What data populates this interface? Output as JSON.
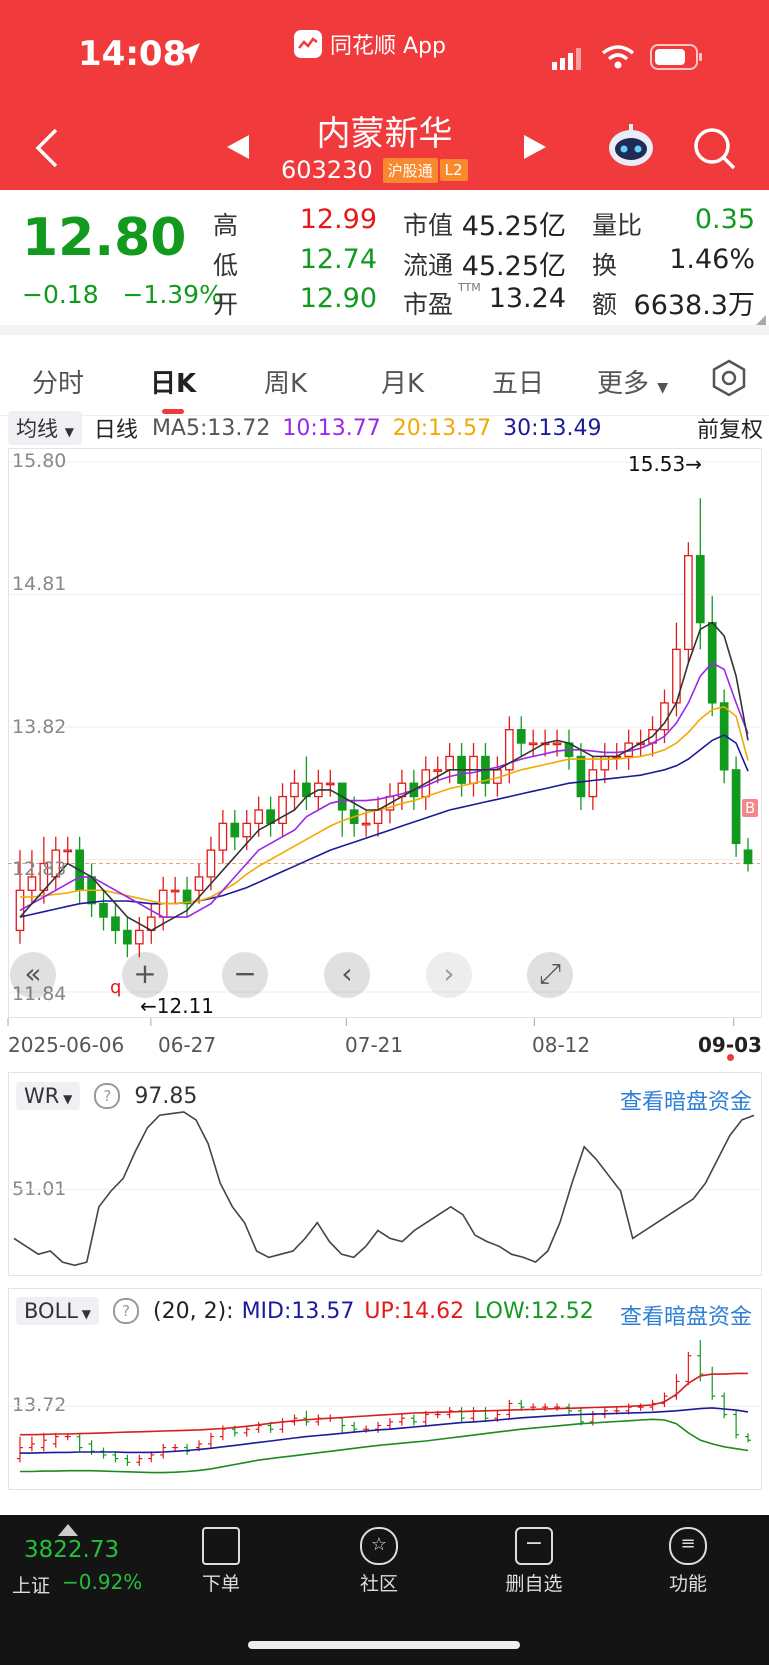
{
  "status": {
    "time": "14:08",
    "app_name": "同花顺 App"
  },
  "header": {
    "stock_name": "内蒙新华",
    "stock_code": "603230",
    "badge_connect": "沪股通",
    "badge_level": "L2"
  },
  "quote": {
    "price": "12.80",
    "change": "−0.18",
    "change_pct": "−1.39%",
    "high_label": "高",
    "high": "12.99",
    "low_label": "低",
    "low": "12.74",
    "open_label": "开",
    "open": "12.90",
    "mktcap_label": "市值",
    "mktcap": "45.25亿",
    "float_label": "流通",
    "float": "45.25亿",
    "pe_label": "市盈",
    "pe_sup": "TTM",
    "pe": "13.24",
    "volratio_label": "量比",
    "volratio": "0.35",
    "turnover_label": "换",
    "turnover": "1.46%",
    "amount_label": "额",
    "amount": "6638.3万"
  },
  "tabs": [
    "分时",
    "日K",
    "周K",
    "月K",
    "五日",
    "更多"
  ],
  "active_tab": 1,
  "ma_row": {
    "selector": "均线",
    "period": "日线",
    "ma5": "MA5:13.72",
    "ma10": "10:13.77",
    "ma20": "20:13.57",
    "ma30": "30:13.49",
    "adjust": "前复权"
  },
  "kline": {
    "y_labels": [
      "15.80",
      "14.81",
      "13.82",
      "12.83",
      "11.84"
    ],
    "high_annot": "15.53→",
    "low_annot": "←12.11",
    "marker_b": "B",
    "marker_q": "q",
    "x_labels": [
      "2025-06-06",
      "06-27",
      "07-21",
      "08-12",
      "09-03"
    ]
  },
  "wr": {
    "name": "WR",
    "value": "97.85",
    "y_label": "51.01",
    "link": "查看暗盘资金"
  },
  "boll": {
    "name": "BOLL",
    "params": "(20, 2):",
    "mid": "MID:13.57",
    "up": "UP:14.62",
    "low": "LOW:12.52",
    "y_label": "13.72",
    "link": "查看暗盘资金"
  },
  "bottom": {
    "index_value": "3822.73",
    "index_name": "上证",
    "index_change": "−0.92%",
    "items": [
      "下单",
      "社区",
      "删自选",
      "功能"
    ]
  },
  "colors": {
    "up": "#e51919",
    "down": "#129a1f",
    "header": "#f03a3c",
    "ma5": "#333333",
    "ma10": "#9b27e8",
    "ma20": "#f2a900",
    "ma30": "#1b1b9a"
  },
  "chart_data": [
    {
      "type": "candlestick",
      "ylim": [
        11.84,
        15.8
      ],
      "x_ticks": [
        "2025-06-06",
        "06-27",
        "07-21",
        "08-12",
        "09-03"
      ],
      "candles": [
        [
          12.3,
          12.6,
          12.9,
          12.2
        ],
        [
          12.6,
          12.7,
          12.9,
          12.5
        ],
        [
          12.6,
          12.8,
          13.0,
          12.5
        ],
        [
          12.7,
          12.9,
          13.0,
          12.6
        ],
        [
          12.9,
          12.9,
          13.0,
          12.8
        ],
        [
          12.9,
          12.6,
          13.0,
          12.5
        ],
        [
          12.7,
          12.5,
          12.8,
          12.4
        ],
        [
          12.5,
          12.4,
          12.6,
          12.3
        ],
        [
          12.4,
          12.3,
          12.5,
          12.2
        ],
        [
          12.3,
          12.2,
          12.4,
          12.1
        ],
        [
          12.2,
          12.3,
          12.4,
          12.1
        ],
        [
          12.3,
          12.4,
          12.5,
          12.2
        ],
        [
          12.4,
          12.6,
          12.7,
          12.3
        ],
        [
          12.6,
          12.6,
          12.7,
          12.5
        ],
        [
          12.6,
          12.5,
          12.7,
          12.4
        ],
        [
          12.6,
          12.7,
          12.8,
          12.5
        ],
        [
          12.7,
          12.9,
          13.0,
          12.6
        ],
        [
          12.9,
          13.1,
          13.2,
          12.8
        ],
        [
          13.1,
          13.0,
          13.2,
          12.9
        ],
        [
          13.0,
          13.1,
          13.2,
          12.9
        ],
        [
          13.1,
          13.2,
          13.3,
          13.0
        ],
        [
          13.2,
          13.1,
          13.3,
          13.0
        ],
        [
          13.1,
          13.3,
          13.4,
          13.0
        ],
        [
          13.3,
          13.4,
          13.5,
          13.2
        ],
        [
          13.4,
          13.3,
          13.6,
          13.2
        ],
        [
          13.3,
          13.4,
          13.5,
          13.2
        ],
        [
          13.4,
          13.4,
          13.5,
          13.3
        ],
        [
          13.4,
          13.2,
          13.4,
          13.0
        ],
        [
          13.2,
          13.1,
          13.3,
          13.0
        ],
        [
          13.1,
          13.1,
          13.2,
          13.0
        ],
        [
          13.1,
          13.2,
          13.3,
          13.0
        ],
        [
          13.2,
          13.3,
          13.4,
          13.1
        ],
        [
          13.3,
          13.4,
          13.5,
          13.2
        ],
        [
          13.4,
          13.3,
          13.5,
          13.2
        ],
        [
          13.3,
          13.5,
          13.6,
          13.2
        ],
        [
          13.5,
          13.5,
          13.6,
          13.4
        ],
        [
          13.5,
          13.6,
          13.7,
          13.4
        ],
        [
          13.6,
          13.4,
          13.7,
          13.3
        ],
        [
          13.4,
          13.6,
          13.7,
          13.3
        ],
        [
          13.6,
          13.4,
          13.7,
          13.3
        ],
        [
          13.4,
          13.5,
          13.6,
          13.3
        ],
        [
          13.5,
          13.8,
          13.9,
          13.4
        ],
        [
          13.8,
          13.7,
          13.9,
          13.6
        ],
        [
          13.7,
          13.7,
          13.8,
          13.6
        ],
        [
          13.7,
          13.7,
          13.8,
          13.6
        ],
        [
          13.7,
          13.7,
          13.8,
          13.6
        ],
        [
          13.7,
          13.6,
          13.8,
          13.5
        ],
        [
          13.6,
          13.3,
          13.7,
          13.2
        ],
        [
          13.3,
          13.5,
          13.6,
          13.2
        ],
        [
          13.5,
          13.6,
          13.7,
          13.4
        ],
        [
          13.6,
          13.6,
          13.7,
          13.5
        ],
        [
          13.6,
          13.7,
          13.8,
          13.5
        ],
        [
          13.7,
          13.7,
          13.8,
          13.6
        ],
        [
          13.7,
          13.8,
          13.9,
          13.6
        ],
        [
          13.8,
          14.0,
          14.1,
          13.7
        ],
        [
          14.0,
          14.4,
          14.6,
          13.9
        ],
        [
          14.4,
          15.1,
          15.2,
          14.3
        ],
        [
          15.1,
          14.6,
          15.53,
          14.4
        ],
        [
          14.6,
          14.0,
          14.8,
          13.9
        ],
        [
          14.0,
          13.5,
          14.1,
          13.4
        ],
        [
          13.5,
          12.95,
          13.6,
          12.85
        ],
        [
          12.9,
          12.8,
          12.99,
          12.74
        ]
      ],
      "ma5": [
        12.4,
        12.5,
        12.6,
        12.7,
        12.8,
        12.75,
        12.7,
        12.6,
        12.5,
        12.4,
        12.35,
        12.3,
        12.35,
        12.4,
        12.45,
        12.55,
        12.65,
        12.75,
        12.85,
        12.95,
        13.05,
        13.1,
        13.15,
        13.2,
        13.3,
        13.35,
        13.35,
        13.3,
        13.25,
        13.2,
        13.2,
        13.25,
        13.3,
        13.35,
        13.4,
        13.45,
        13.5,
        13.5,
        13.5,
        13.5,
        13.5,
        13.55,
        13.6,
        13.65,
        13.7,
        13.72,
        13.7,
        13.65,
        13.6,
        13.6,
        13.6,
        13.65,
        13.7,
        13.75,
        13.85,
        14.0,
        14.3,
        14.55,
        14.6,
        14.5,
        14.2,
        13.72
      ],
      "ma10": [
        12.45,
        12.5,
        12.55,
        12.6,
        12.65,
        12.7,
        12.7,
        12.65,
        12.6,
        12.55,
        12.5,
        12.45,
        12.4,
        12.4,
        12.4,
        12.45,
        12.5,
        12.6,
        12.7,
        12.8,
        12.9,
        12.95,
        13.0,
        13.05,
        13.15,
        13.2,
        13.25,
        13.27,
        13.27,
        13.27,
        13.28,
        13.3,
        13.32,
        13.35,
        13.38,
        13.42,
        13.45,
        13.47,
        13.48,
        13.5,
        13.52,
        13.55,
        13.58,
        13.6,
        13.62,
        13.64,
        13.65,
        13.65,
        13.64,
        13.63,
        13.63,
        13.64,
        13.66,
        13.7,
        13.75,
        13.85,
        14.0,
        14.2,
        14.3,
        14.25,
        14.0,
        13.77
      ],
      "ma20": [
        12.55,
        12.55,
        12.56,
        12.57,
        12.58,
        12.6,
        12.6,
        12.6,
        12.58,
        12.56,
        12.54,
        12.52,
        12.5,
        12.5,
        12.51,
        12.52,
        12.55,
        12.6,
        12.65,
        12.72,
        12.78,
        12.83,
        12.88,
        12.93,
        12.98,
        13.03,
        13.08,
        13.12,
        13.15,
        13.18,
        13.2,
        13.22,
        13.25,
        13.27,
        13.3,
        13.33,
        13.36,
        13.38,
        13.4,
        13.42,
        13.44,
        13.47,
        13.5,
        13.52,
        13.54,
        13.56,
        13.58,
        13.58,
        13.58,
        13.58,
        13.58,
        13.59,
        13.6,
        13.62,
        13.65,
        13.7,
        13.78,
        13.88,
        13.95,
        13.97,
        13.9,
        13.57
      ],
      "ma30": [
        12.4,
        12.42,
        12.44,
        12.46,
        12.48,
        12.5,
        12.51,
        12.52,
        12.52,
        12.52,
        12.51,
        12.5,
        12.5,
        12.5,
        12.51,
        12.52,
        12.54,
        12.56,
        12.59,
        12.62,
        12.66,
        12.7,
        12.74,
        12.78,
        12.82,
        12.86,
        12.9,
        12.93,
        12.96,
        12.99,
        13.02,
        13.05,
        13.08,
        13.11,
        13.14,
        13.17,
        13.2,
        13.22,
        13.24,
        13.26,
        13.28,
        13.3,
        13.32,
        13.34,
        13.36,
        13.38,
        13.4,
        13.41,
        13.42,
        13.43,
        13.44,
        13.45,
        13.46,
        13.48,
        13.5,
        13.53,
        13.58,
        13.65,
        13.72,
        13.76,
        13.7,
        13.49
      ]
    },
    {
      "type": "line",
      "title": "WR",
      "value": 97.85,
      "ylim": [
        0,
        100
      ],
      "values": [
        20,
        15,
        10,
        12,
        5,
        3,
        5,
        40,
        50,
        58,
        75,
        90,
        98,
        99,
        100,
        95,
        80,
        55,
        40,
        30,
        12,
        8,
        10,
        12,
        20,
        30,
        18,
        10,
        8,
        15,
        25,
        20,
        18,
        25,
        30,
        35,
        40,
        35,
        22,
        18,
        15,
        10,
        8,
        5,
        12,
        30,
        55,
        78,
        70,
        60,
        50,
        20,
        25,
        30,
        35,
        40,
        45,
        55,
        70,
        85,
        95,
        97.85
      ]
    },
    {
      "type": "line",
      "title": "BOLL",
      "ylim": [
        11.5,
        15.8
      ],
      "series": [
        {
          "name": "MID",
          "values": [
            12.45,
            12.45,
            12.46,
            12.47,
            12.47,
            12.48,
            12.48,
            12.48,
            12.48,
            12.47,
            12.47,
            12.47,
            12.48,
            12.5,
            12.52,
            12.55,
            12.58,
            12.62,
            12.66,
            12.7,
            12.74,
            12.78,
            12.82,
            12.86,
            12.9,
            12.93,
            12.96,
            12.99,
            13.02,
            13.05,
            13.08,
            13.1,
            13.13,
            13.16,
            13.19,
            13.22,
            13.25,
            13.28,
            13.3,
            13.32,
            13.35,
            13.38,
            13.41,
            13.43,
            13.45,
            13.47,
            13.49,
            13.5,
            13.51,
            13.52,
            13.53,
            13.54,
            13.55,
            13.56,
            13.58,
            13.6,
            13.63,
            13.66,
            13.68,
            13.65,
            13.62,
            13.57
          ]
        },
        {
          "name": "UP",
          "values": [
            12.95,
            12.95,
            12.96,
            12.97,
            12.97,
            12.98,
            12.99,
            13.0,
            13.01,
            13.02,
            13.03,
            13.04,
            13.05,
            13.06,
            13.07,
            13.08,
            13.1,
            13.12,
            13.15,
            13.18,
            13.22,
            13.26,
            13.3,
            13.33,
            13.36,
            13.38,
            13.4,
            13.42,
            13.44,
            13.46,
            13.48,
            13.5,
            13.52,
            13.54,
            13.55,
            13.56,
            13.57,
            13.58,
            13.59,
            13.6,
            13.61,
            13.62,
            13.63,
            13.64,
            13.65,
            13.66,
            13.67,
            13.68,
            13.69,
            13.7,
            13.71,
            13.72,
            13.74,
            13.76,
            13.85,
            14.05,
            14.35,
            14.55,
            14.6,
            14.6,
            14.62,
            14.62
          ]
        },
        {
          "name": "LOW",
          "values": [
            11.95,
            11.95,
            11.96,
            11.96,
            11.97,
            11.97,
            11.97,
            11.96,
            11.95,
            11.94,
            11.93,
            11.92,
            11.92,
            11.93,
            11.95,
            11.98,
            12.02,
            12.08,
            12.14,
            12.2,
            12.26,
            12.3,
            12.34,
            12.38,
            12.42,
            12.46,
            12.5,
            12.54,
            12.58,
            12.62,
            12.66,
            12.69,
            12.72,
            12.75,
            12.78,
            12.82,
            12.86,
            12.9,
            12.94,
            12.98,
            13.02,
            13.06,
            13.1,
            13.13,
            13.16,
            13.19,
            13.22,
            13.25,
            13.27,
            13.29,
            13.31,
            13.33,
            13.35,
            13.37,
            13.35,
            13.25,
            13.0,
            12.8,
            12.7,
            12.62,
            12.57,
            12.52
          ]
        }
      ]
    }
  ]
}
